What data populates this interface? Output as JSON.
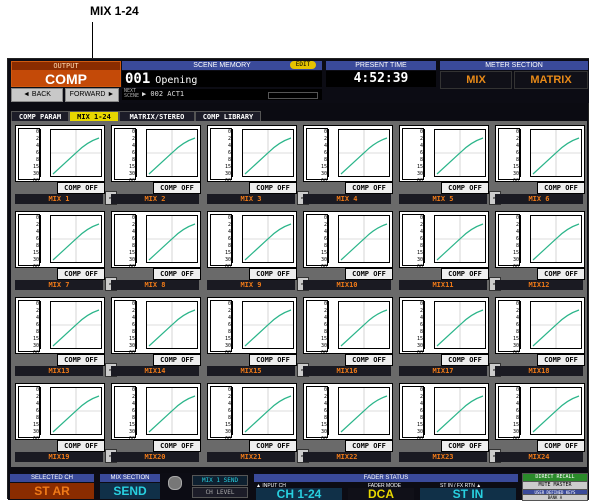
{
  "callout": {
    "label": "MIX 1-24"
  },
  "output": {
    "header": "OUTPUT",
    "value": "COMP"
  },
  "nav": {
    "back": "◄ BACK",
    "forward": "FORWARD ►"
  },
  "scene_memory": {
    "header": "SCENE MEMORY",
    "edit_badge": "EDIT",
    "number": "001",
    "name": "Opening",
    "next_label": "NEXT SCENE",
    "next_value": "▶ 002 ACT1"
  },
  "present_time": {
    "header": "PRESENT TIME",
    "value": "4:52:39"
  },
  "meter_section": {
    "header": "METER SECTION",
    "mix": "MIX",
    "matrix": "MATRIX"
  },
  "tabs": [
    {
      "label": "COMP PARAM"
    },
    {
      "label": "MIX 1-24"
    },
    {
      "label": "MATRIX/STEREO"
    },
    {
      "label": "COMP LIBRARY"
    }
  ],
  "scale_labels": [
    "0",
    "2",
    "4",
    "6",
    "8",
    "15",
    "30",
    "60"
  ],
  "channels": [
    {
      "name": "MIX 1",
      "comp": "COMP OFF",
      "linked": true
    },
    {
      "name": "MIX 2",
      "comp": "COMP OFF",
      "linked": false
    },
    {
      "name": "MIX 3",
      "comp": "COMP OFF",
      "linked": true
    },
    {
      "name": "MIX 4",
      "comp": "COMP OFF",
      "linked": false
    },
    {
      "name": "MIX 5",
      "comp": "COMP OFF",
      "linked": true
    },
    {
      "name": "MIX 6",
      "comp": "COMP OFF",
      "linked": false
    },
    {
      "name": "MIX 7",
      "comp": "COMP OFF",
      "linked": true
    },
    {
      "name": "MIX 8",
      "comp": "COMP OFF",
      "linked": false
    },
    {
      "name": "MIX 9",
      "comp": "COMP OFF",
      "linked": true
    },
    {
      "name": "MIX10",
      "comp": "COMP OFF",
      "linked": false
    },
    {
      "name": "MIX11",
      "comp": "COMP OFF",
      "linked": true
    },
    {
      "name": "MIX12",
      "comp": "COMP OFF",
      "linked": false
    },
    {
      "name": "MIX13",
      "comp": "COMP OFF",
      "linked": true
    },
    {
      "name": "MIX14",
      "comp": "COMP OFF",
      "linked": false
    },
    {
      "name": "MIX15",
      "comp": "COMP OFF",
      "linked": true
    },
    {
      "name": "MIX16",
      "comp": "COMP OFF",
      "linked": false
    },
    {
      "name": "MIX17",
      "comp": "COMP OFF",
      "linked": true
    },
    {
      "name": "MIX18",
      "comp": "COMP OFF",
      "linked": false
    },
    {
      "name": "MIX19",
      "comp": "COMP OFF",
      "linked": true
    },
    {
      "name": "MIX20",
      "comp": "COMP OFF",
      "linked": false
    },
    {
      "name": "MIX21",
      "comp": "COMP OFF",
      "linked": true
    },
    {
      "name": "MIX22",
      "comp": "COMP OFF",
      "linked": false
    },
    {
      "name": "MIX23",
      "comp": "COMP OFF",
      "linked": true
    },
    {
      "name": "MIX24",
      "comp": "COMP OFF",
      "linked": false
    }
  ],
  "bottom": {
    "selected_ch": {
      "header": "SELECTED CH",
      "value": "ST AR"
    },
    "mix_section": {
      "header": "MIX SECTION",
      "value": "SEND"
    },
    "mix_send": "MIX 1 SEND",
    "ch_level": "CH LEVEL",
    "fader_status": {
      "header": "FADER STATUS",
      "input_ch_label": "▲ INPUT CH",
      "input_ch_value": "CH 1-24",
      "fader_mode_label": "FADER MODE",
      "fader_mode_value": "DCA",
      "stin_label": "ST IN / FX RTN ▲",
      "stin_value": "ST IN"
    },
    "direct_recall": "DIRECT RECALL",
    "mute_master": "MUTE MASTER",
    "user_defined_keys": "USER DEFINED KEYS",
    "bank": "BANK A"
  },
  "colors": {
    "accent_orange": "#f07a18",
    "tab_active": "#e8d800",
    "header_blue": "#3a4a9a",
    "graph_green": "#2bb58a",
    "cyan": "#28d0e0"
  }
}
